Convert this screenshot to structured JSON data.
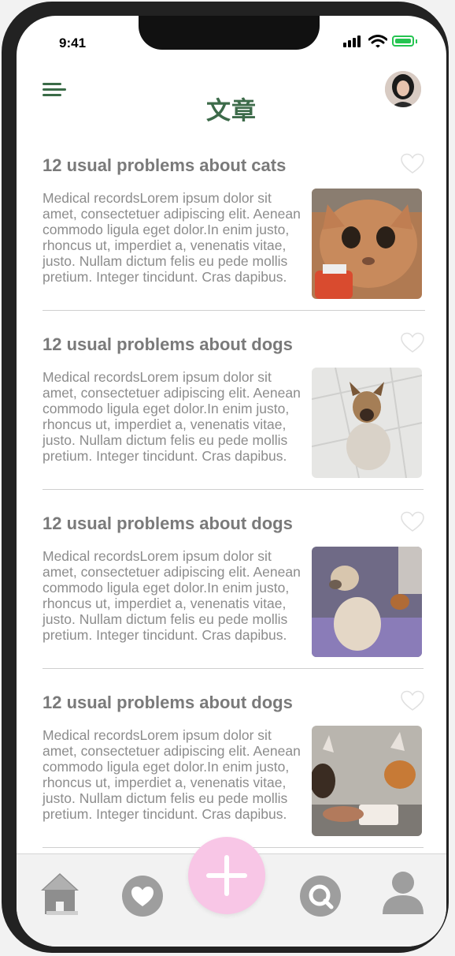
{
  "status_bar": {
    "time": "9:41"
  },
  "header": {
    "title": "文章"
  },
  "articles": [
    {
      "title": "12 usual problems about  cats",
      "body": "Medical recordsLorem ipsum dolor sit amet, consectetuer adipiscing elit. Aenean commodo ligula eget dolor.In enim justo, rhoncus ut, imperdiet a, venenatis vitae, justo. Nullam dictum felis eu pede mollis pretium. Integer tincidunt. Cras dapibus."
    },
    {
      "title": "12 usual problems about  dogs",
      "body": "Medical recordsLorem ipsum dolor sit amet, consectetuer adipiscing elit. Aenean commodo ligula eget dolor.In enim justo, rhoncus ut, imperdiet a, venenatis vitae, justo. Nullam dictum felis eu pede mollis pretium. Integer tincidunt. Cras dapibus."
    },
    {
      "title": "12 usual problems about  dogs",
      "body": "Medical recordsLorem ipsum dolor sit amet, consectetuer adipiscing elit. Aenean commodo ligula eget dolor.In enim justo, rhoncus ut, imperdiet a, venenatis vitae, justo. Nullam dictum felis eu pede mollis pretium. Integer tincidunt. Cras dapibus."
    },
    {
      "title": "12 usual problems about  dogs",
      "body": "Medical recordsLorem ipsum dolor sit amet, consectetuer adipiscing elit. Aenean commodo ligula eget dolor.In enim justo, rhoncus ut, imperdiet a, venenatis vitae, justo. Nullam dictum felis eu pede mollis pretium. Integer tincidunt. Cras dapibus."
    }
  ],
  "tabbar": {
    "tabs": [
      "home-icon",
      "heart-icon",
      "add-icon",
      "search-icon",
      "profile-icon"
    ]
  },
  "colors": {
    "accent": "#3d6b4a",
    "fab": "#f8c6e6",
    "battery": "#25c451"
  }
}
